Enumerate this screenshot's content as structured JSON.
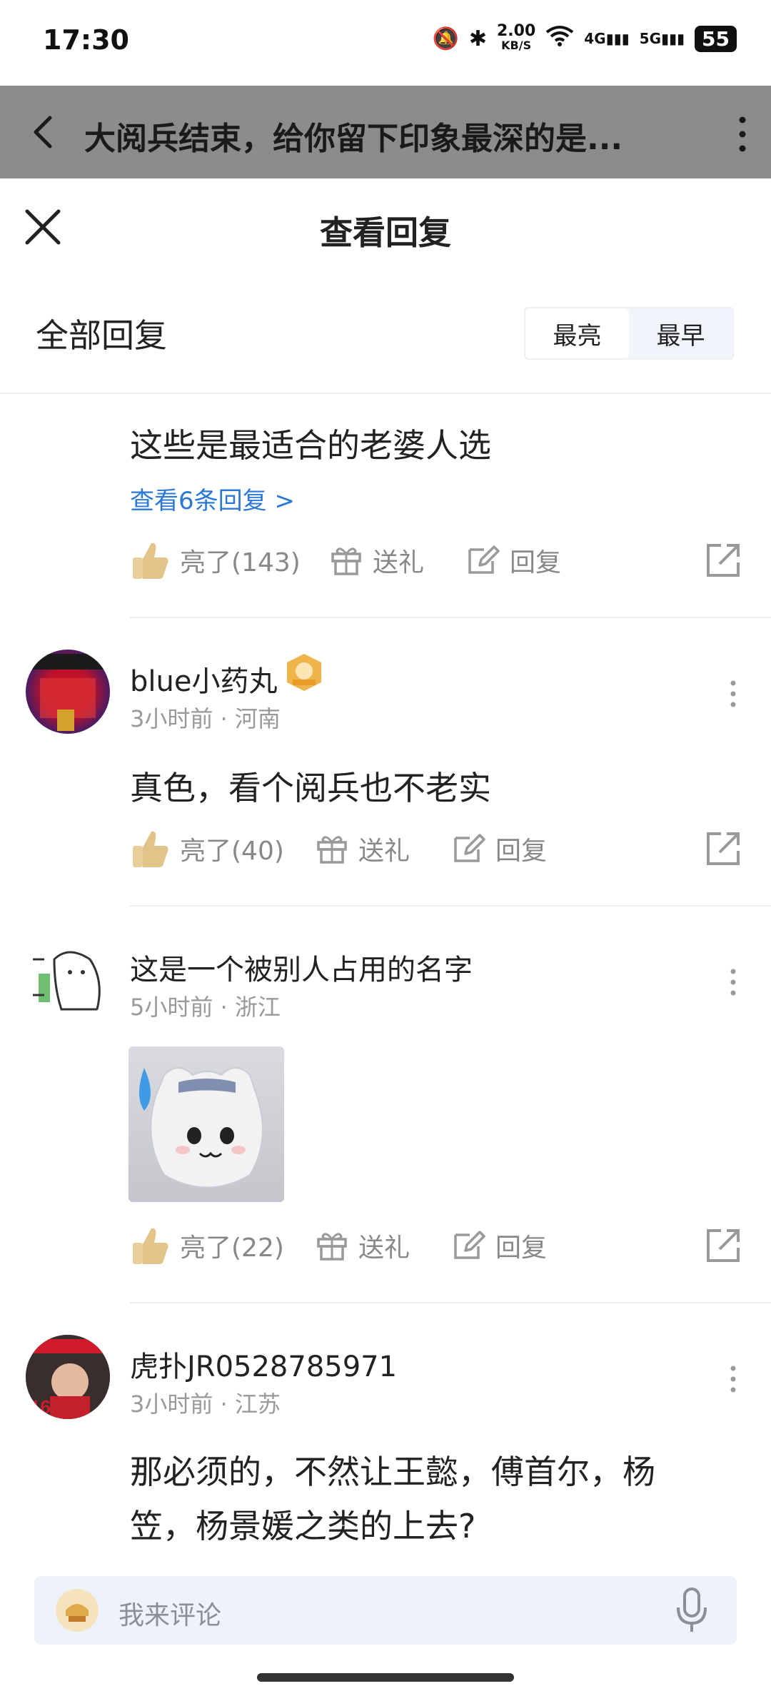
{
  "status": {
    "time": "17:30",
    "net_speed_value": "2.00",
    "net_speed_unit": "KB/S",
    "network_4g": "4G",
    "network_5g": "5G",
    "battery": "55"
  },
  "header": {
    "title": "大阅兵结束，给你留下印象最深的是..."
  },
  "sheet": {
    "title": "查看回复",
    "section_title": "全部回复",
    "sort": {
      "option_1": "最亮",
      "option_2": "最早"
    }
  },
  "top_comment": {
    "text": "这些是最适合的老婆人选",
    "view_replies": "查看6条回复 >",
    "like": "亮了(143)",
    "gift": "送礼",
    "reply": "回复"
  },
  "comments": [
    {
      "user": "blue小药丸",
      "meta": "3小时前 · 河南",
      "text": "真色，看个阅兵也不老实",
      "like": "亮了(40)",
      "gift": "送礼",
      "reply": "回复"
    },
    {
      "user": "这是一个被别人占用的名字",
      "meta": "5小时前 · 浙江",
      "like": "亮了(22)",
      "gift": "送礼",
      "reply": "回复"
    },
    {
      "user": "虎扑JR0528785971",
      "meta": "3小时前 · 江苏",
      "text_line1": "那必须的，不然让王懿，傅首尔，杨",
      "text_line2": "笠，杨景媛之类的上去?"
    }
  ],
  "bottom": {
    "placeholder": "我来评论"
  },
  "colors": {
    "link": "#2b78d6",
    "header_bg": "#8c8c8c",
    "meta": "#999999"
  },
  "icons": [
    "back-icon",
    "more-icon",
    "close-icon",
    "thumb-up-icon",
    "gift-icon",
    "reply-icon",
    "share-icon",
    "mic-icon"
  ]
}
